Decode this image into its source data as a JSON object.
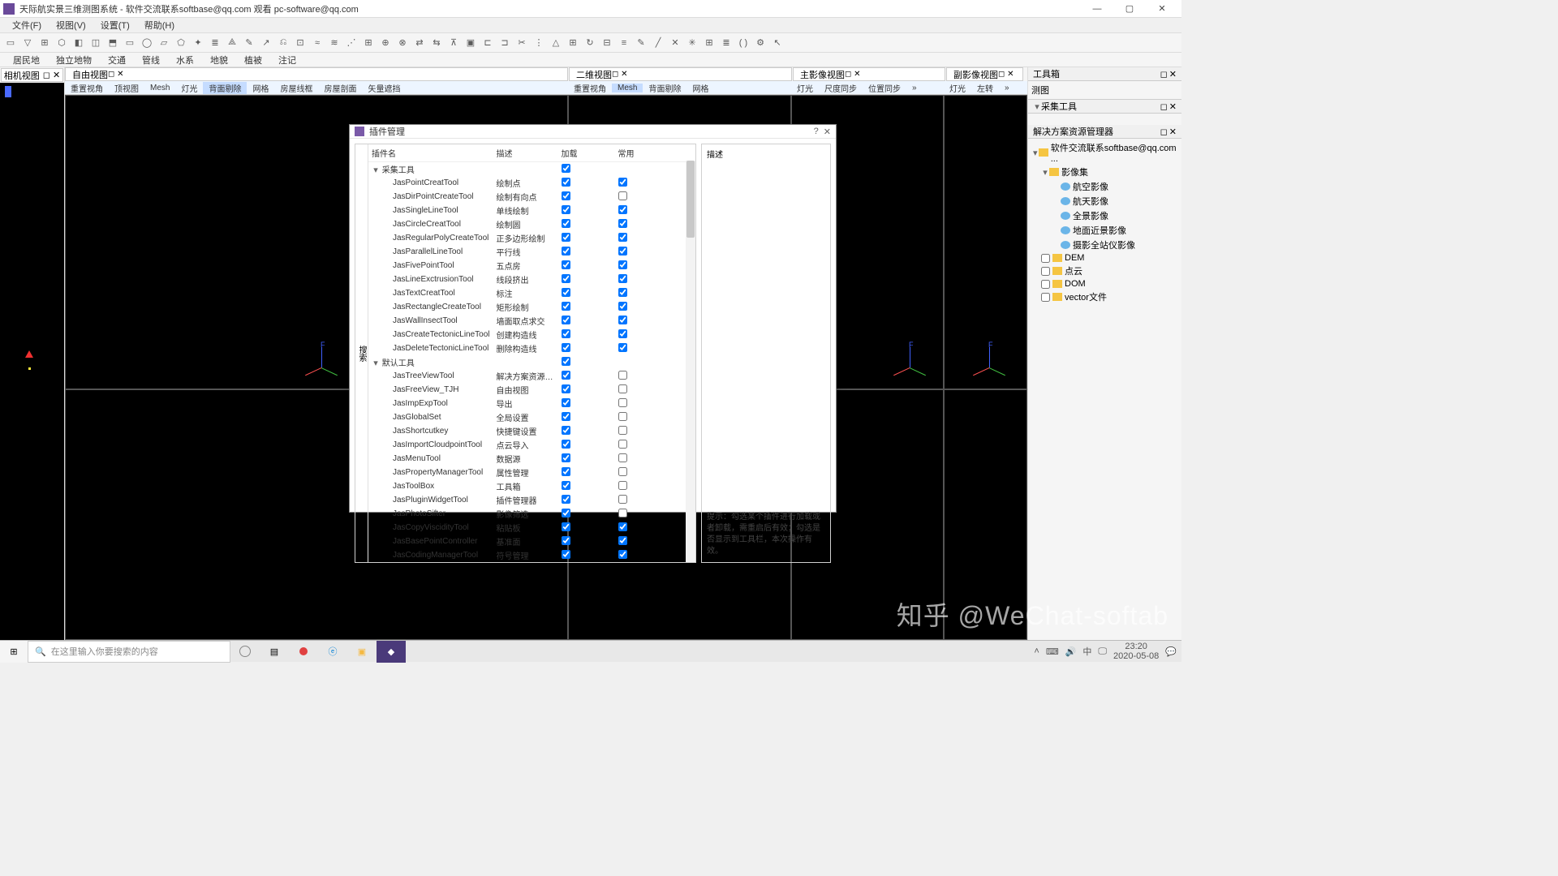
{
  "title": "天际航实景三维测图系统 - 软件交流联系softbase@qq.com 观看 pc-software@qq.com",
  "menu": [
    "文件(F)",
    "视图(V)",
    "设置(T)",
    "帮助(H)"
  ],
  "ribbon": [
    "居民地",
    "独立地物",
    "交通",
    "管线",
    "水系",
    "地貌",
    "植被",
    "注记"
  ],
  "leftDockTab": "相机视图",
  "views": {
    "free": "自由视图",
    "twoD": "二维视图",
    "mainImg": "主影像视图",
    "subImg": "副影像视图",
    "toolbox": "工具箱"
  },
  "viewToolbars": {
    "free": [
      "重置视角",
      "顶视图",
      "Mesh",
      "灯光",
      "背面剔除",
      "网格",
      "房屋线框",
      "房屋剖面",
      "矢量遮挡"
    ],
    "twoD": [
      "重置视角",
      "Mesh",
      "背面剔除",
      "网格"
    ],
    "mainImg": [
      "灯光",
      "尺度同步",
      "位置同步"
    ],
    "subImg": [
      "灯光",
      "左转"
    ]
  },
  "rightPanel": {
    "collect": "采集工具",
    "mapping": "测图",
    "solution": "解决方案资源管理器",
    "tree": {
      "root": "软件交流联系softbase@qq.com ...",
      "imgset": "影像集",
      "items": [
        "航空影像",
        "航天影像",
        "全景影像",
        "地面近景影像",
        "摄影全站仪影像"
      ],
      "dem": "DEM",
      "pointcloud": "点云",
      "dom": "DOM",
      "vector": "vector文件"
    }
  },
  "dialog": {
    "title": "插件管理",
    "sideLabel": "搜索",
    "headers": [
      "插件名",
      "描述",
      "加载",
      "常用"
    ],
    "group1": "采集工具",
    "group2": "默认工具",
    "descLabel": "描述",
    "hint": "提示：勾选某个插件进行加载或者卸载，需重启后有效；勾选是否显示到工具栏，本次操作有效。",
    "plugins1": [
      {
        "name": "JasPointCreatTool",
        "desc": "绘制点",
        "load": true,
        "common": true
      },
      {
        "name": "JasDirPointCreateTool",
        "desc": "绘制有向点",
        "load": true,
        "common": false
      },
      {
        "name": "JasSingleLineTool",
        "desc": "单线绘制",
        "load": true,
        "common": true
      },
      {
        "name": "JasCircleCreatTool",
        "desc": "绘制圆",
        "load": true,
        "common": true
      },
      {
        "name": "JasRegularPolyCreateTool",
        "desc": "正多边形绘制",
        "load": true,
        "common": true
      },
      {
        "name": "JasParallelLineTool",
        "desc": "平行线",
        "load": true,
        "common": true
      },
      {
        "name": "JasFivePointTool",
        "desc": "五点房",
        "load": true,
        "common": true
      },
      {
        "name": "JasLineExctrusionTool",
        "desc": "线段挤出",
        "load": true,
        "common": true
      },
      {
        "name": "JasTextCreatTool",
        "desc": "标注",
        "load": true,
        "common": true
      },
      {
        "name": "JasRectangleCreateTool",
        "desc": "矩形绘制",
        "load": true,
        "common": true
      },
      {
        "name": "JasWallInsectTool",
        "desc": "墙面取点求交",
        "load": true,
        "common": true
      },
      {
        "name": "JasCreateTectonicLineTool",
        "desc": "创建构造线",
        "load": true,
        "common": true
      },
      {
        "name": "JasDeleteTectonicLineTool",
        "desc": "删除构造线",
        "load": true,
        "common": true
      }
    ],
    "plugins2": [
      {
        "name": "JasTreeViewTool",
        "desc": "解决方案资源…",
        "load": true,
        "common": false
      },
      {
        "name": "JasFreeView_TJH",
        "desc": "自由视图",
        "load": true,
        "common": false
      },
      {
        "name": "JasImpExpTool",
        "desc": "导出",
        "load": true,
        "common": false
      },
      {
        "name": "JasGlobalSet",
        "desc": "全局设置",
        "load": true,
        "common": false
      },
      {
        "name": "JasShortcutkey",
        "desc": "快捷键设置",
        "load": true,
        "common": false
      },
      {
        "name": "JasImportCloudpointTool",
        "desc": "点云导入",
        "load": true,
        "common": false
      },
      {
        "name": "JasMenuTool",
        "desc": "数据源",
        "load": true,
        "common": false
      },
      {
        "name": "JasPropertyManagerTool",
        "desc": "属性管理",
        "load": true,
        "common": false
      },
      {
        "name": "JasToolBox",
        "desc": "工具箱",
        "load": true,
        "common": false
      },
      {
        "name": "JasPluginWidgetTool",
        "desc": "插件管理器",
        "load": true,
        "common": false
      },
      {
        "name": "JasPhotoSifter",
        "desc": "影像筛选",
        "load": true,
        "common": false
      },
      {
        "name": "JasCopyViscidityTool",
        "desc": "粘贴板",
        "load": true,
        "common": true
      },
      {
        "name": "JasBasePointController",
        "desc": "基准面",
        "load": true,
        "common": true
      },
      {
        "name": "JasCodingManagerTool",
        "desc": "符号管理",
        "load": true,
        "common": true
      }
    ]
  },
  "taskbar": {
    "searchPlaceholder": "在这里输入你要搜索的内容",
    "time": "23:20",
    "date": "2020-05-08"
  },
  "watermark": "知乎 @WeChat-softab"
}
